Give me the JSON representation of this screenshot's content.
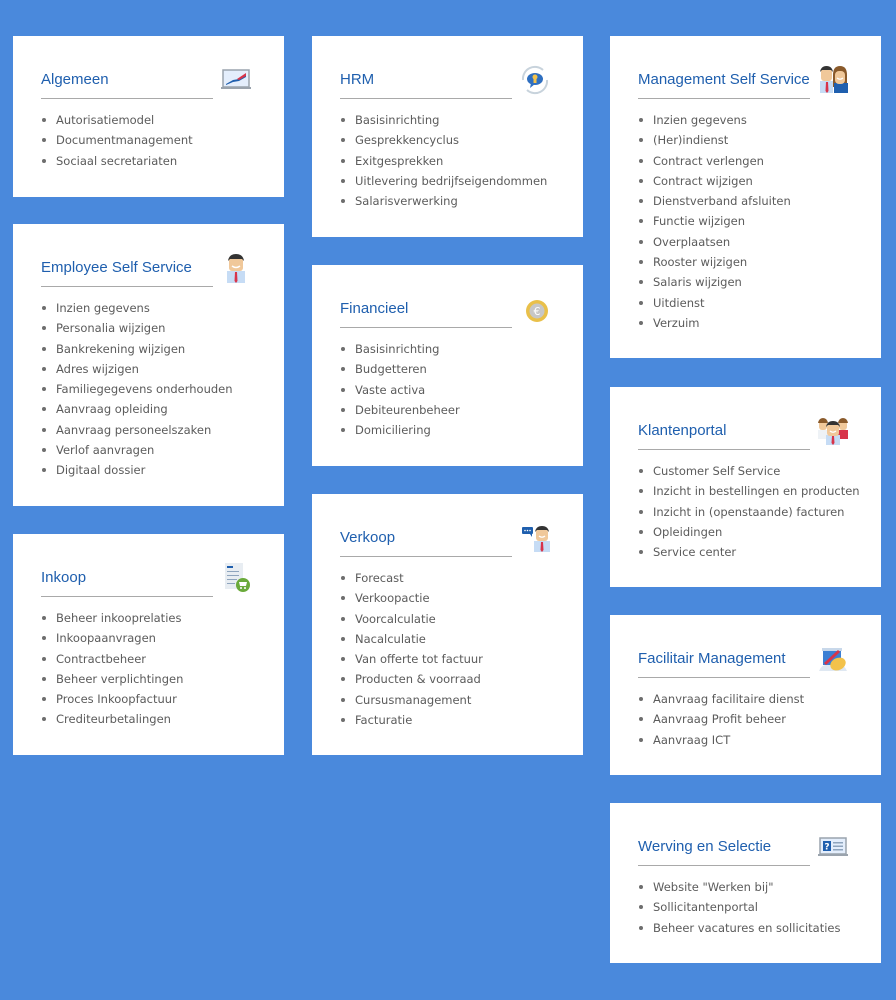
{
  "colors": {
    "background": "#4a89dc",
    "card": "#ffffff",
    "title": "#1f5fae",
    "text": "#5b5b5b",
    "divider": "#a9a9a9"
  },
  "cards": {
    "algemeen": {
      "title": "Algemeen",
      "icon": "laptop-chart-icon",
      "items": [
        "Autorisatiemodel",
        "Documentmanagement",
        "Sociaal secretariaten"
      ]
    },
    "hrm": {
      "title": "HRM",
      "icon": "conversation-cycle-icon",
      "items": [
        "Basisinrichting",
        "Gesprekkencyclus",
        "Exitgesprekken",
        "Uitlevering bedrijfseigendommen",
        "Salarisverwerking"
      ]
    },
    "mss": {
      "title": "Management Self Service",
      "icon": "man-woman-icon",
      "items": [
        "Inzien gegevens",
        "(Her)indienst",
        "Contract verlengen",
        "Contract wijzigen",
        "Dienstverband afsluiten",
        "Functie wijzigen",
        "Overplaatsen",
        "Rooster wijzigen",
        "Salaris wijzigen",
        "Uitdienst",
        "Verzuim"
      ]
    },
    "ess": {
      "title": "Employee Self Service",
      "icon": "employee-icon",
      "items": [
        "Inzien gegevens",
        "Personalia wijzigen",
        "Bankrekening wijzigen",
        "Adres wijzigen",
        "Familiegegevens onderhouden",
        "Aanvraag opleiding",
        "Aanvraag personeelszaken",
        "Verlof aanvragen",
        "Digitaal dossier"
      ]
    },
    "financieel": {
      "title": "Financieel",
      "icon": "euro-coin-icon",
      "items": [
        "Basisinrichting",
        "Budgetteren",
        "Vaste activa",
        "Debiteurenbeheer",
        "Domiciliering"
      ]
    },
    "klantenportal": {
      "title": "Klantenportal",
      "icon": "customer-group-icon",
      "items": [
        "Customer Self Service",
        "Inzicht in bestellingen en producten",
        "Inzicht in (openstaande) facturen",
        "Opleidingen",
        "Service center"
      ]
    },
    "inkoop": {
      "title": "Inkoop",
      "icon": "purchase-list-cart-icon",
      "items": [
        "Beheer inkooprelaties",
        "Inkoopaanvragen",
        "Contractbeheer",
        "Beheer verplichtingen",
        "Proces Inkoopfactuur",
        "Crediteurbetalingen"
      ]
    },
    "verkoop": {
      "title": "Verkoop",
      "icon": "salesman-chat-icon",
      "items": [
        "Forecast",
        "Verkoopactie",
        "Voorcalculatie",
        "Nacalculatie",
        "Van offerte tot factuur",
        "Producten & voorraad",
        "Cursusmanagement",
        "Facturatie"
      ]
    },
    "facilitair": {
      "title": "Facilitair Management",
      "icon": "cleaning-icon",
      "items": [
        "Aanvraag facilitaire dienst",
        "Aanvraag Profit beheer",
        "Aanvraag ICT"
      ]
    },
    "werving": {
      "title": "Werving en Selectie",
      "icon": "vacancy-laptop-icon",
      "items": [
        "Website \"Werken bij\"",
        "Sollicitantenportal",
        "Beheer vacatures en sollicitaties"
      ]
    }
  }
}
